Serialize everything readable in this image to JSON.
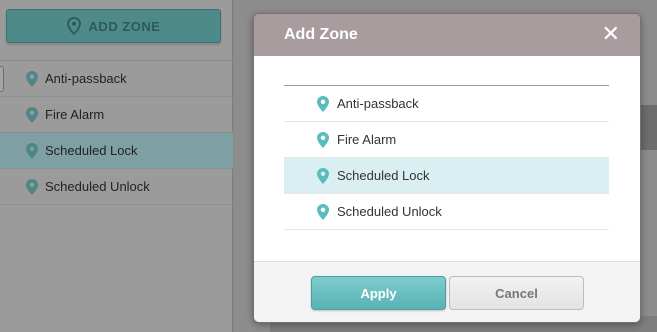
{
  "sidebar": {
    "add_zone_label": "ADD ZONE",
    "items": [
      {
        "label": "Anti-passback",
        "icon": "map-pin-icon"
      },
      {
        "label": "Fire Alarm",
        "icon": "map-pin-icon"
      },
      {
        "label": "Scheduled Lock",
        "icon": "map-pin-icon",
        "selected": true
      },
      {
        "label": "Scheduled Unlock",
        "icon": "map-pin-icon"
      }
    ]
  },
  "modal": {
    "title": "Add Zone",
    "close_icon": "close-icon",
    "items": [
      {
        "label": "Anti-passback",
        "icon": "map-pin-icon"
      },
      {
        "label": "Fire Alarm",
        "icon": "map-pin-icon"
      },
      {
        "label": "Scheduled Lock",
        "icon": "map-pin-icon",
        "selected": true
      },
      {
        "label": "Scheduled Unlock",
        "icon": "map-pin-icon"
      }
    ],
    "apply_label": "Apply",
    "cancel_label": "Cancel"
  },
  "colors": {
    "accent": "#59b2b5",
    "selected_row": "#d9eff1",
    "header": "#a99c9e",
    "pin": "#5bbcbc"
  }
}
